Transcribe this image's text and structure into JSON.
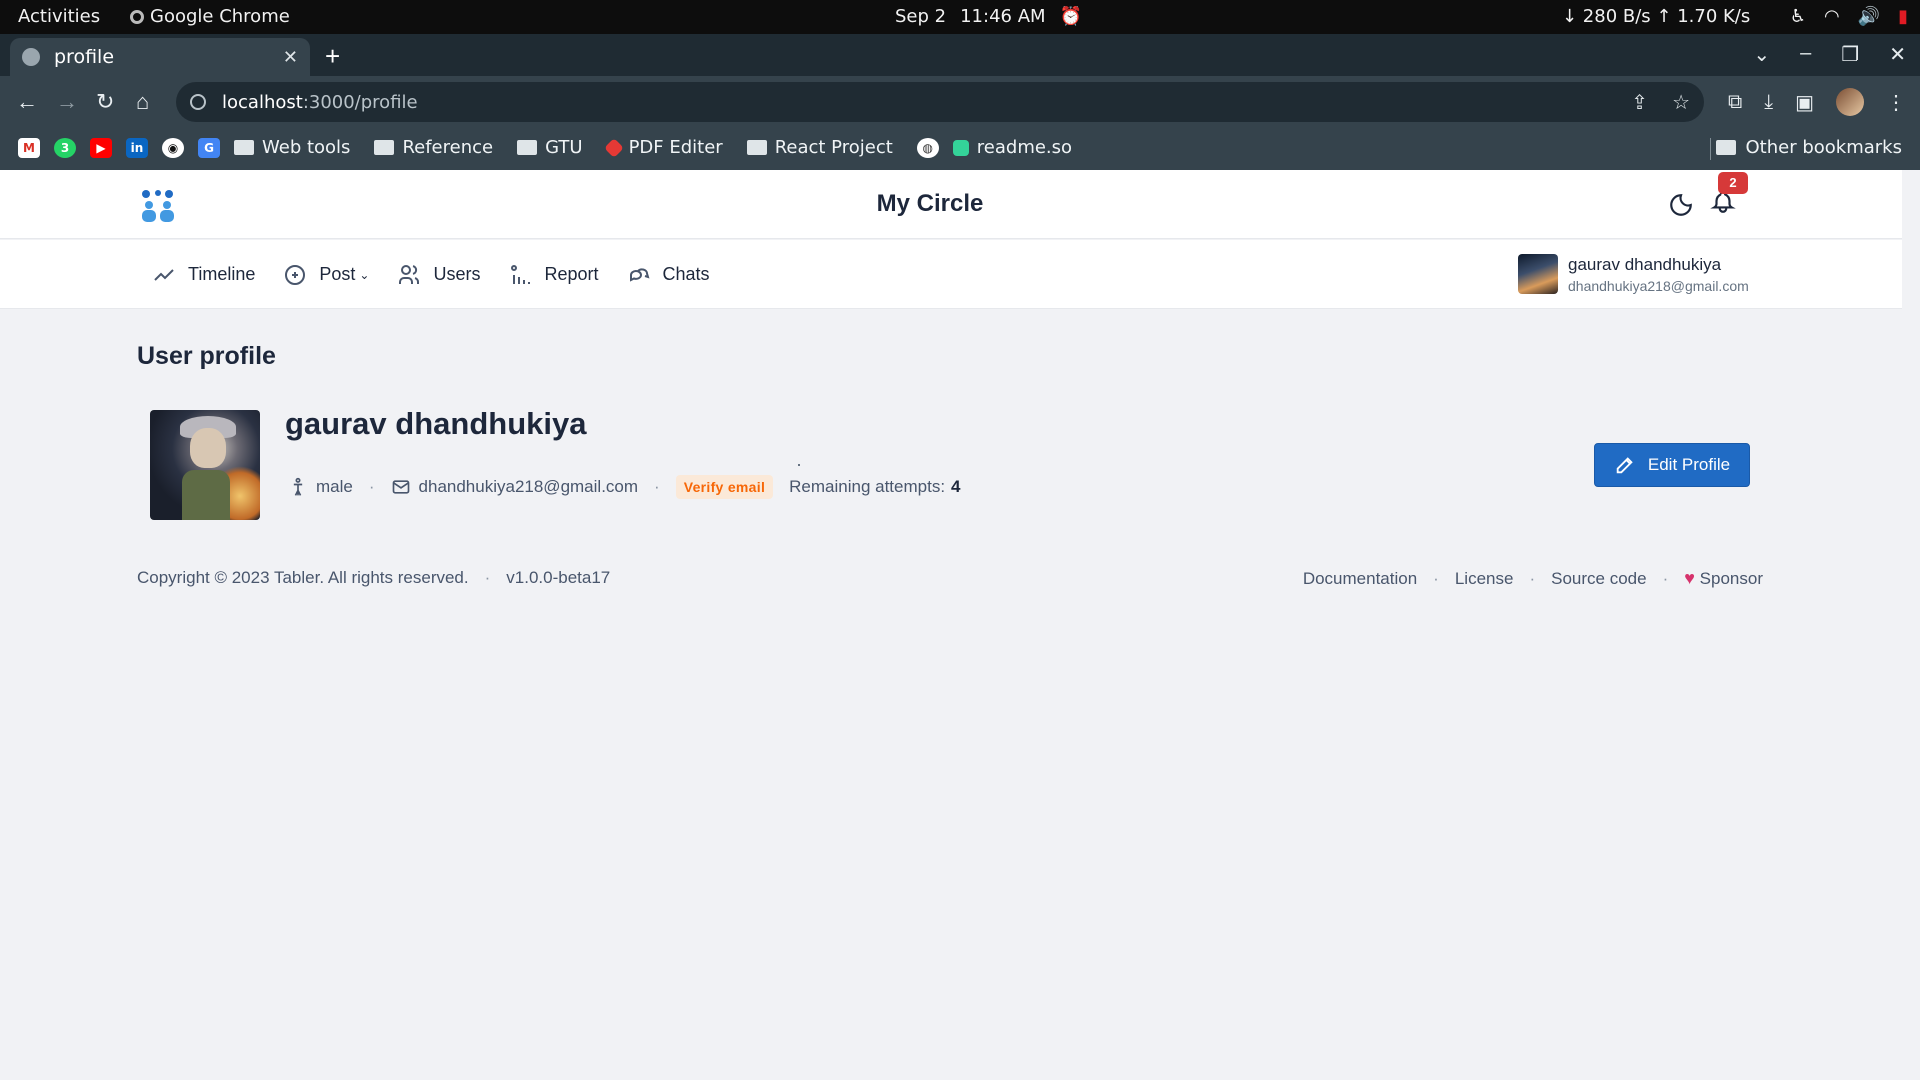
{
  "system_bar": {
    "activities": "Activities",
    "app_name": "Google Chrome",
    "date": "Sep 2",
    "time": "11:46 AM",
    "network_speed": "↓ 280 B/s ↑ 1.70 K/s"
  },
  "browser": {
    "tab_title": "profile",
    "url_host": "localhost",
    "url_path": ":3000/profile",
    "bookmarks": [
      "Web tools",
      "Reference",
      "GTU",
      "PDF Editer",
      "React Project",
      "readme.so"
    ],
    "other_bookmarks": "Other bookmarks"
  },
  "app": {
    "brand": "My Circle",
    "notification_count": "2",
    "nav": [
      {
        "label": "Timeline",
        "icon": "trend-line-icon"
      },
      {
        "label": "Post",
        "icon": "plus-circle-icon"
      },
      {
        "label": "Users",
        "icon": "users-icon"
      },
      {
        "label": "Report",
        "icon": "report-icon"
      },
      {
        "label": "Chats",
        "icon": "chat-icon"
      }
    ],
    "user": {
      "name": "gaurav dhandhukiya",
      "email": "dhandhukiya218@gmail.com"
    }
  },
  "profile": {
    "page_title": "User profile",
    "name": "gaurav dhandhukiya",
    "gender": "male",
    "email": "dhandhukiya218@gmail.com",
    "verify_label": "Verify email",
    "attempts_label": "Remaining attempts:",
    "attempts_value": "4",
    "edit_button": "Edit Profile"
  },
  "footer": {
    "copyright": "Copyright © 2023 Tabler. All rights reserved.",
    "version": "v1.0.0-beta17",
    "links": [
      "Documentation",
      "License",
      "Source code",
      "Sponsor"
    ]
  },
  "colors": {
    "primary": "#206bc4",
    "badge": "#d63939",
    "verify_text": "#f76707",
    "verify_bg": "#fbe9d8",
    "heart": "#d6336c"
  }
}
